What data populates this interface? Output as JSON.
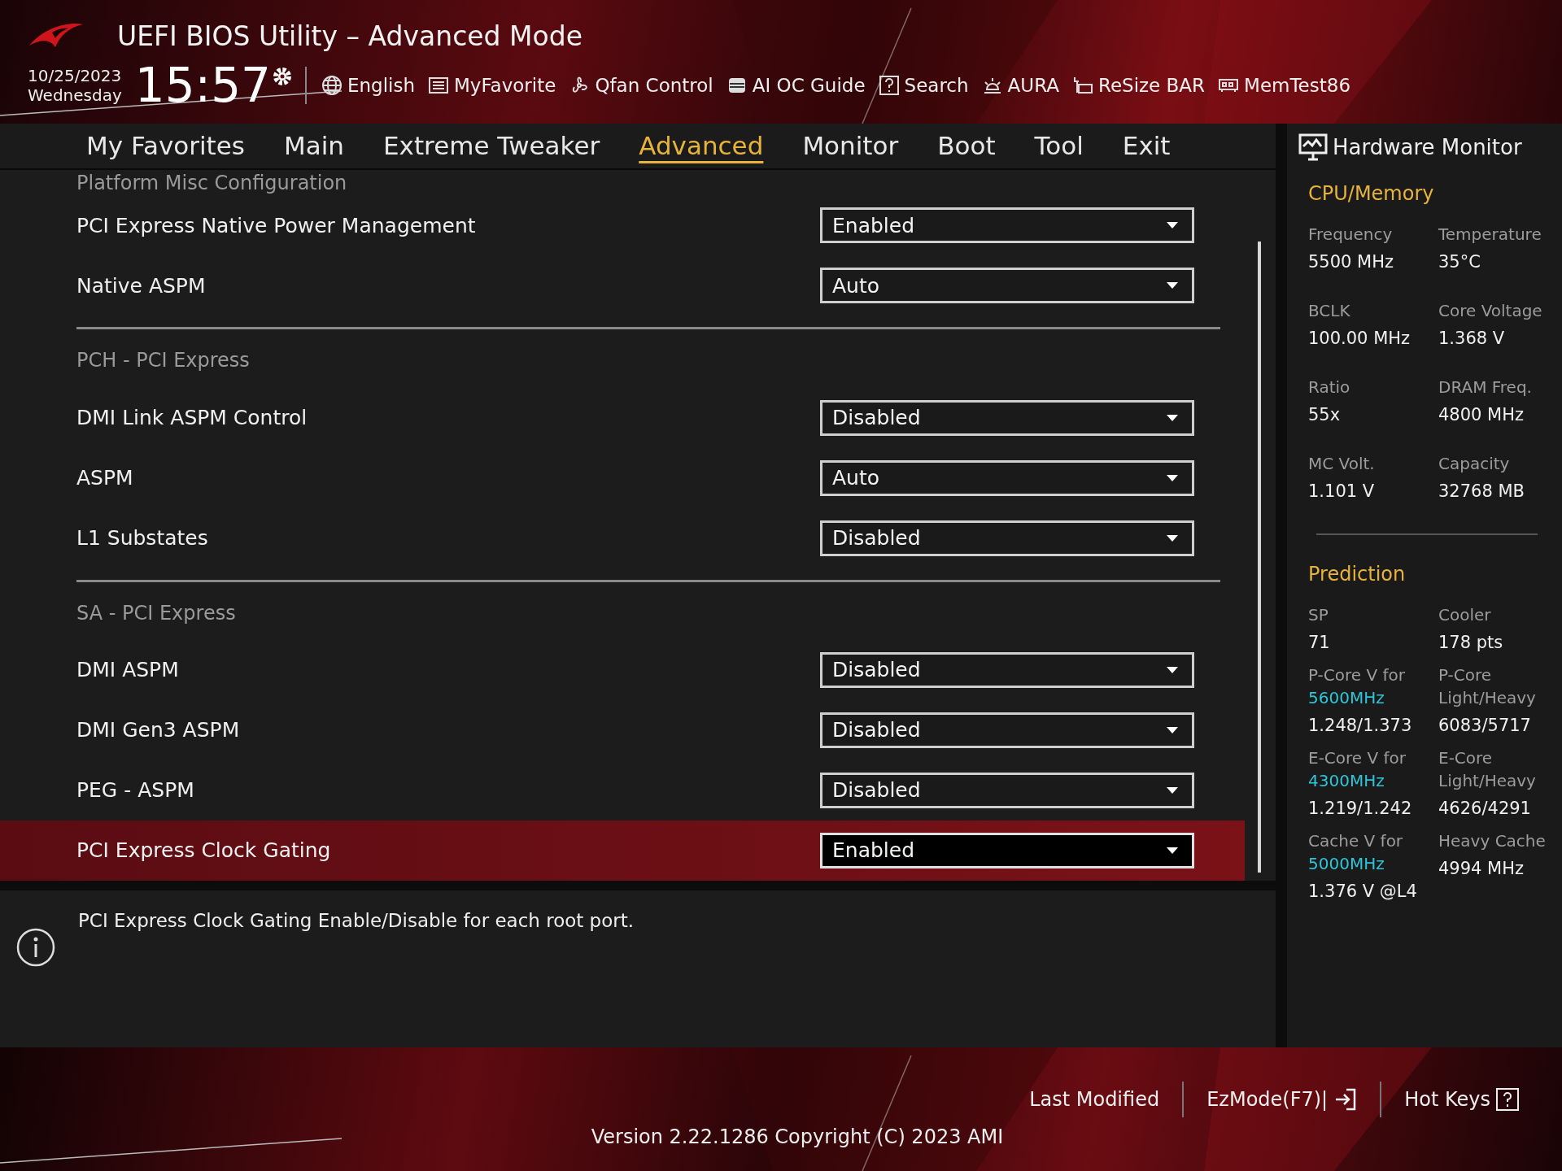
{
  "header": {
    "title": "UEFI BIOS Utility – Advanced Mode",
    "date": "10/25/2023",
    "weekday": "Wednesday",
    "time": "15:57",
    "toolbar": [
      {
        "kind": "globe",
        "label": "English"
      },
      {
        "kind": "favorite",
        "label": "MyFavorite"
      },
      {
        "kind": "fan",
        "label": "Qfan Control"
      },
      {
        "kind": "chip",
        "label": "AI OC Guide"
      },
      {
        "kind": "help",
        "label": "Search"
      },
      {
        "kind": "light",
        "label": "AURA"
      },
      {
        "kind": "card",
        "label": "ReSize BAR"
      },
      {
        "kind": "memory",
        "label": "MemTest86"
      }
    ]
  },
  "tabs": [
    {
      "label": "My Favorites",
      "selected": false
    },
    {
      "label": "Main",
      "selected": false
    },
    {
      "label": "Extreme Tweaker",
      "selected": false
    },
    {
      "label": "Advanced",
      "selected": true
    },
    {
      "label": "Monitor",
      "selected": false
    },
    {
      "label": "Boot",
      "selected": false
    },
    {
      "label": "Tool",
      "selected": false
    },
    {
      "label": "Exit",
      "selected": false
    }
  ],
  "settings": [
    {
      "kind": "heading",
      "label": "Platform Misc Configuration"
    },
    {
      "kind": "setting",
      "label": "PCI Express Native Power Management",
      "value": "Enabled",
      "selected": false
    },
    {
      "kind": "setting",
      "label": "Native ASPM",
      "value": "Auto",
      "selected": false
    },
    {
      "kind": "heading",
      "label": "PCH - PCI Express"
    },
    {
      "kind": "setting",
      "label": "DMI Link ASPM Control",
      "value": "Disabled",
      "selected": false
    },
    {
      "kind": "setting",
      "label": "ASPM",
      "value": "Auto",
      "selected": false
    },
    {
      "kind": "setting",
      "label": "L1 Substates",
      "value": "Disabled",
      "selected": false
    },
    {
      "kind": "heading",
      "label": "SA - PCI Express"
    },
    {
      "kind": "setting",
      "label": "DMI ASPM",
      "value": "Disabled",
      "selected": false
    },
    {
      "kind": "setting",
      "label": "DMI Gen3 ASPM",
      "value": "Disabled",
      "selected": false
    },
    {
      "kind": "setting",
      "label": "PEG - ASPM",
      "value": "Disabled",
      "selected": false
    },
    {
      "kind": "setting",
      "label": "PCI Express Clock Gating",
      "value": "Enabled",
      "selected": true
    }
  ],
  "help_text": "PCI Express Clock Gating Enable/Disable for each root port.",
  "hardware_monitor": {
    "title": "Hardware Monitor",
    "sections": [
      {
        "title": "CPU/Memory",
        "spaced": true,
        "items": [
          {
            "label": "Frequency",
            "value": "5500 MHz"
          },
          {
            "label": "Temperature",
            "value": "35°C"
          },
          {
            "label": "BCLK",
            "value": "100.00 MHz"
          },
          {
            "label": "Core Voltage",
            "value": "1.368 V"
          },
          {
            "label": "Ratio",
            "value": "55x"
          },
          {
            "label": "DRAM Freq.",
            "value": "4800 MHz"
          },
          {
            "label": "MC Volt.",
            "value": "1.101 V"
          },
          {
            "label": "Capacity",
            "value": "32768 MB"
          }
        ]
      },
      {
        "title": "Prediction",
        "spaced": false,
        "items": [
          {
            "label": "SP",
            "value": "71"
          },
          {
            "label": "Cooler",
            "value": "178 pts"
          },
          {
            "label": "P-Core V for",
            "highlight": "5600MHz",
            "value": "1.248/1.373"
          },
          {
            "label": "P-Core Light/Heavy",
            "value": "6083/5717"
          },
          {
            "label": "E-Core V for",
            "highlight": "4300MHz",
            "value": "1.219/1.242"
          },
          {
            "label": "E-Core Light/Heavy",
            "value": "4626/4291"
          },
          {
            "label": "Cache V for",
            "highlight": "5000MHz",
            "value": "1.376 V @L4"
          },
          {
            "label": "Heavy Cache",
            "value": "4994 MHz"
          }
        ]
      }
    ]
  },
  "footer": {
    "buttons": [
      {
        "kind": "plain",
        "label": "Last Modified"
      },
      {
        "kind": "exit",
        "label": "EzMode(F7)|"
      },
      {
        "kind": "help",
        "label": "Hot Keys"
      }
    ],
    "version": "Version 2.22.1286 Copyright (C) 2023 AMI"
  }
}
